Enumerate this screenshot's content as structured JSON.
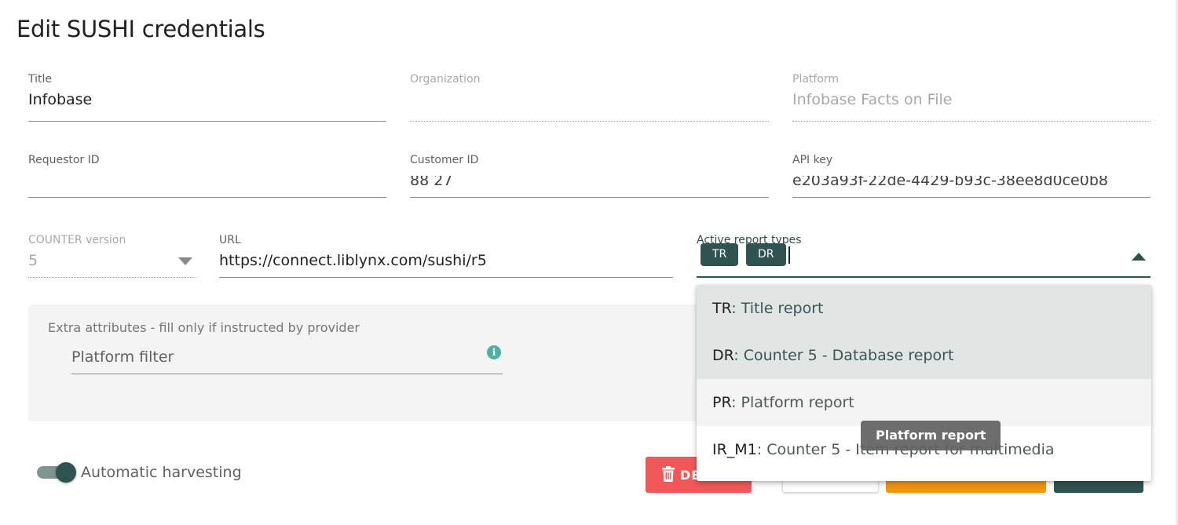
{
  "dialog": {
    "title": "Edit SUSHI credentials"
  },
  "fields": {
    "title": {
      "label": "Title",
      "value": "Infobase"
    },
    "organization": {
      "label": "Organization",
      "value": ""
    },
    "platform": {
      "label": "Platform",
      "value": "Infobase Facts on File"
    },
    "requestor_id": {
      "label": "Requestor ID",
      "value": ""
    },
    "customer_id": {
      "label": "Customer ID",
      "value": "88  27"
    },
    "api_key": {
      "label": "API key",
      "value": "e203a93f-22de-4429-b93c-38ee8d0ce0b8"
    },
    "counter_version": {
      "label": "COUNTER version",
      "value": "5"
    },
    "url": {
      "label": "URL",
      "value": "https://connect.liblynx.com/sushi/r5"
    },
    "report_types": {
      "label": "Active report types",
      "chips": [
        "TR",
        "DR"
      ]
    }
  },
  "extra": {
    "title": "Extra attributes - fill only if instructed by provider",
    "platform_filter_placeholder": "Platform filter"
  },
  "toggle": {
    "label": "Automatic harvesting",
    "on": true
  },
  "buttons": {
    "delete": "DE"
  },
  "menu": {
    "items": [
      {
        "code": "TR",
        "text": ": Title report",
        "state": "selected"
      },
      {
        "code": "DR",
        "text": ": Counter 5 - Database report",
        "state": "selected"
      },
      {
        "code": "PR",
        "text": ": Platform report",
        "state": "hover"
      },
      {
        "code": "IR_M1",
        "text": ": Counter 5 - Item report for multimedia",
        "state": "normal"
      }
    ]
  },
  "tooltip": {
    "text": "Platform report"
  },
  "colors": {
    "primary": "#2f5350",
    "danger": "#f25858",
    "warning": "#f2950f",
    "info": "#4cb3a3"
  }
}
